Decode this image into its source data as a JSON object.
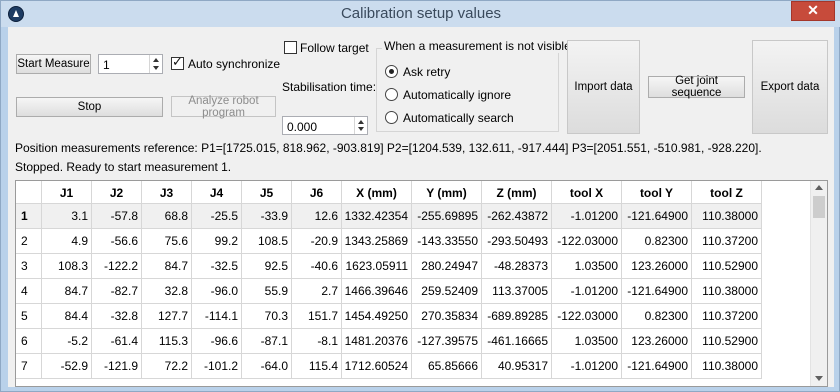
{
  "window": {
    "title": "Calibration setup values",
    "close_glyph": "✕"
  },
  "controls": {
    "start_measure": "Start Measure",
    "count_value": "1",
    "auto_sync_label": "Auto synchronize",
    "auto_sync_checked": true,
    "stop": "Stop",
    "analyze_robot_program": "Analyze robot program",
    "follow_target_label": "Follow target",
    "follow_target_checked": false,
    "stabilisation_label": "Stabilisation time:",
    "stabilisation_value": "0.000",
    "import_data": "Import data",
    "get_joint_sequence": "Get joint sequence",
    "export_data": "Export data"
  },
  "visibility_group": {
    "title": "When a measurement is not visible",
    "options": [
      {
        "label": "Ask retry",
        "checked": true
      },
      {
        "label": "Automatically ignore",
        "checked": false
      },
      {
        "label": "Automatically search",
        "checked": false
      }
    ]
  },
  "info": {
    "reference": "Position measurements reference: P1=[1725.015, 818.962, -903.819]  P2=[1204.539, 132.611, -917.444]  P3=[2051.551, -510.981, -928.220].",
    "status": "Stopped. Ready to start measurement 1."
  },
  "table": {
    "headers": [
      "",
      "J1",
      "J2",
      "J3",
      "J4",
      "J5",
      "J6",
      "X (mm)",
      "Y (mm)",
      "Z (mm)",
      "tool X",
      "tool Y",
      "tool Z"
    ],
    "rows": [
      [
        "1",
        "3.1",
        "-57.8",
        "68.8",
        "-25.5",
        "-33.9",
        "12.6",
        "1332.42354",
        "-255.69895",
        "-262.43872",
        "-1.01200",
        "-121.64900",
        "110.38000"
      ],
      [
        "2",
        "4.9",
        "-56.6",
        "75.6",
        "99.2",
        "108.5",
        "-20.9",
        "1343.25869",
        "-143.33550",
        "-293.50493",
        "-122.03000",
        "0.82300",
        "110.37200"
      ],
      [
        "3",
        "108.3",
        "-122.2",
        "84.7",
        "-32.5",
        "92.5",
        "-40.6",
        "1623.05911",
        "280.24947",
        "-48.28373",
        "1.03500",
        "123.26000",
        "110.52900"
      ],
      [
        "4",
        "84.7",
        "-82.7",
        "32.8",
        "-96.0",
        "55.9",
        "2.7",
        "1466.39646",
        "259.52409",
        "113.37005",
        "-1.01200",
        "-121.64900",
        "110.38000"
      ],
      [
        "5",
        "84.4",
        "-32.8",
        "127.7",
        "-114.1",
        "70.3",
        "151.7",
        "1454.49250",
        "270.35834",
        "-689.89285",
        "-122.03000",
        "0.82300",
        "110.37200"
      ],
      [
        "6",
        "-5.2",
        "-61.4",
        "115.3",
        "-96.6",
        "-87.1",
        "-8.1",
        "1481.20376",
        "-127.39575",
        "-461.16665",
        "1.03500",
        "123.26000",
        "110.52900"
      ],
      [
        "7",
        "-52.9",
        "-121.9",
        "72.2",
        "-101.2",
        "-64.0",
        "115.4",
        "1712.60524",
        "65.85666",
        "40.95317",
        "-1.01200",
        "-121.64900",
        "110.38000"
      ]
    ],
    "selected_row": 0
  },
  "colors": {
    "title_bg": "#cbdcee",
    "close_bg": "#c74b3b",
    "selected_row": "#f0f0f0"
  }
}
